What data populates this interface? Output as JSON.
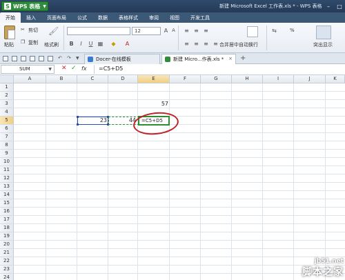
{
  "app": {
    "menu_button": "WPS 表格",
    "window_title": "新建 Microsoft Excel 工作表.xls * - WPS 表格"
  },
  "menu": {
    "items": [
      "开始",
      "插入",
      "页面布局",
      "公式",
      "数据",
      "表格样式",
      "审阅",
      "视图",
      "开发工具"
    ],
    "active": "开始"
  },
  "ribbon": {
    "paste": "粘贴",
    "cut": "剪切",
    "copy": "复制",
    "format_painter": "格式刷",
    "font_size": "12",
    "merge_center": "合并居中",
    "wrap_text": "自动换行",
    "highlight": "突出显示",
    "percent": "%"
  },
  "tabs": {
    "docer": "Docer-在线模板",
    "workbook": "新建 Micro...作表.xls *"
  },
  "formula_bar": {
    "name_box": "SUM",
    "fx": "fx",
    "formula": "=C5+D5"
  },
  "sheet": {
    "columns": [
      "A",
      "B",
      "C",
      "D",
      "E",
      "F",
      "G",
      "H",
      "I",
      "J",
      "K"
    ],
    "rows": [
      "1",
      "2",
      "3",
      "4",
      "5",
      "6",
      "7",
      "8",
      "9",
      "10",
      "11",
      "12",
      "13",
      "14",
      "15",
      "16",
      "17",
      "18",
      "19",
      "20",
      "21",
      "22",
      "23",
      "24"
    ],
    "active_column": "E",
    "active_row": "5",
    "cells": {
      "E3": "57",
      "C5": "23",
      "D5": "44",
      "E5": "=C5+D5"
    }
  },
  "colors": {
    "accent_green": "#2f8c3c",
    "ref_blue": "#2a4ea8",
    "ref_green": "#2e8b2e",
    "annotation_red": "#c0222a"
  },
  "watermark": {
    "url": "jb51.net",
    "name": "脚本之家"
  }
}
